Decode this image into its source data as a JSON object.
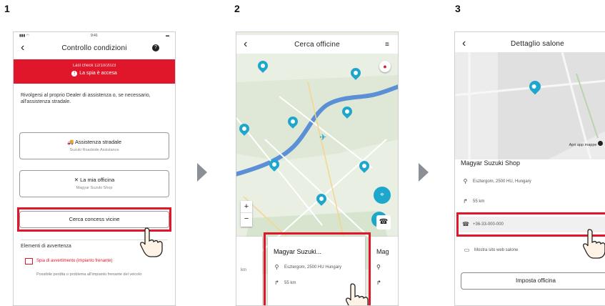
{
  "steps": [
    {
      "number": "1"
    },
    {
      "number": "2"
    },
    {
      "number": "3"
    }
  ],
  "screen1": {
    "status_time": "9:41",
    "title": "Controllo condizioni",
    "alert_line1": "Last check 12/10/2023",
    "alert_line2": "La spia è accesa",
    "message": "Rivolgersi al proprio Dealer di assistenza o, se necessario, all'assistenza stradale.",
    "roadside_button": "Assistenza stradale",
    "roadside_sub": "Suzuki Roadside Assistance",
    "workshop_button": "La mia officina",
    "workshop_sub": "Magyar Suzuki Shop",
    "nearby_button": "Cerca concess vicine",
    "warning_section": "Elementi di avvertenza",
    "warning_item": "Spia di avvertimento (impianto frenante)",
    "warning_desc": "Possibile perdita o problema all'impianto frenante del veicolo"
  },
  "screen2": {
    "title": "Cerca officine",
    "card_title": "Magyar Suzuki...",
    "card_address": "Esztergom, 2500 HU Hungary",
    "card_distance": "55 km",
    "card_side_dist": "km",
    "card_next_title": "Mag",
    "zoom_in": "+",
    "zoom_out": "−"
  },
  "screen3": {
    "title": "Dettaglio salone",
    "open_maps": "Apri app mappe",
    "name": "Magyar Suzuki Shop",
    "address": "Esztergom, 2500 HU, Hungary",
    "distance": "55 km",
    "phone": "+36-33-000-000",
    "website": "Mostra sito web salone",
    "set_button": "Imposta officina"
  },
  "colors": {
    "accent_red": "#e0162b",
    "pin": "#1ea7cc",
    "river": "#5b8fd6"
  }
}
